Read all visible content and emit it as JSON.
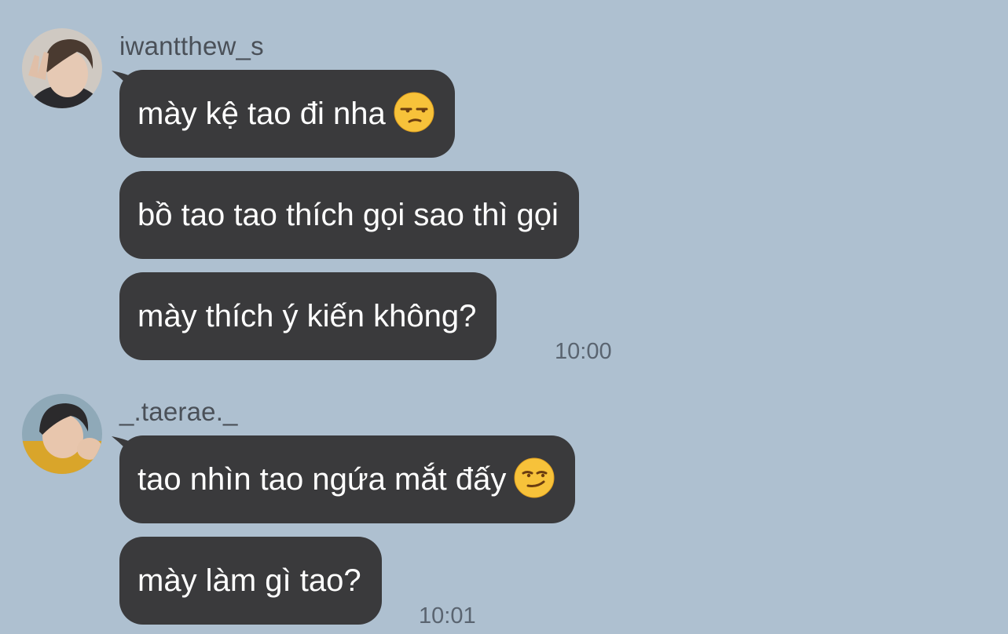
{
  "messages_group_1": {
    "sender": "iwantthew_s",
    "avatar_icon": "user-avatar-icon",
    "bubbles": [
      {
        "text": "mày kệ tao đi nha",
        "emoji": "unamused-face-icon"
      },
      {
        "text": "bồ tao tao thích gọi sao thì gọi"
      },
      {
        "text": "mày thích ý kiến không?"
      }
    ],
    "time": "10:00"
  },
  "messages_group_2": {
    "sender": "_.taerae._",
    "avatar_icon": "user-avatar-icon",
    "bubbles": [
      {
        "text": "tao nhìn tao ngứa mắt đấy",
        "emoji": "smirking-face-icon"
      },
      {
        "text": "mày làm gì tao?"
      }
    ],
    "time": "10:01"
  },
  "colors": {
    "background": "#aec0d0",
    "bubble": "#3a3a3c",
    "bubble_text": "#ffffff",
    "meta_text": "#4a5058"
  }
}
